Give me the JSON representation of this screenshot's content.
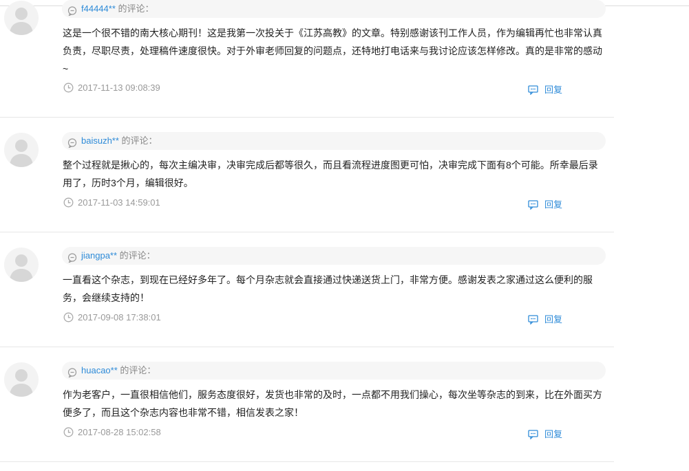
{
  "comments": [
    {
      "user": "f44444**",
      "suffix": " 的评论：",
      "text": "这是一个很不错的南大核心期刊！这是我第一次投关于《江苏高教》的文章。特别感谢该刊工作人员，作为编辑再忙也非常认真负责，尽职尽责，处理稿件速度很快。对于外审老师回复的问题点，还特地打电话来与我讨论应该怎样修改。真的是非常的感动~",
      "time": "2017-11-13 09:08:39",
      "reply": "回复"
    },
    {
      "user": "baisuzh**",
      "suffix": " 的评论：",
      "text": "整个过程就是揪心的，每次主编决审，决审完成后都等很久，而且看流程进度图更可怕，决审完成下面有8个可能。所幸最后录用了，历时3个月，编辑很好。",
      "time": "2017-11-03 14:59:01",
      "reply": "回复"
    },
    {
      "user": "jiangpa**",
      "suffix": " 的评论：",
      "text": "一直看这个杂志，到现在已经好多年了。每个月杂志就会直接通过快递送货上门，非常方便。感谢发表之家通过这么便利的服务，会继续支持的！",
      "time": "2017-09-08 17:38:01",
      "reply": "回复"
    },
    {
      "user": "huacao**",
      "suffix": " 的评论：",
      "text": "作为老客户，一直很相信他们，服务态度很好，发货也非常的及时，一点都不用我们操心，每次坐等杂志的到来，比在外面买方便多了，而且这个杂志内容也非常不错，相信发表之家！",
      "time": "2017-08-28 15:02:58",
      "reply": "回复"
    }
  ]
}
